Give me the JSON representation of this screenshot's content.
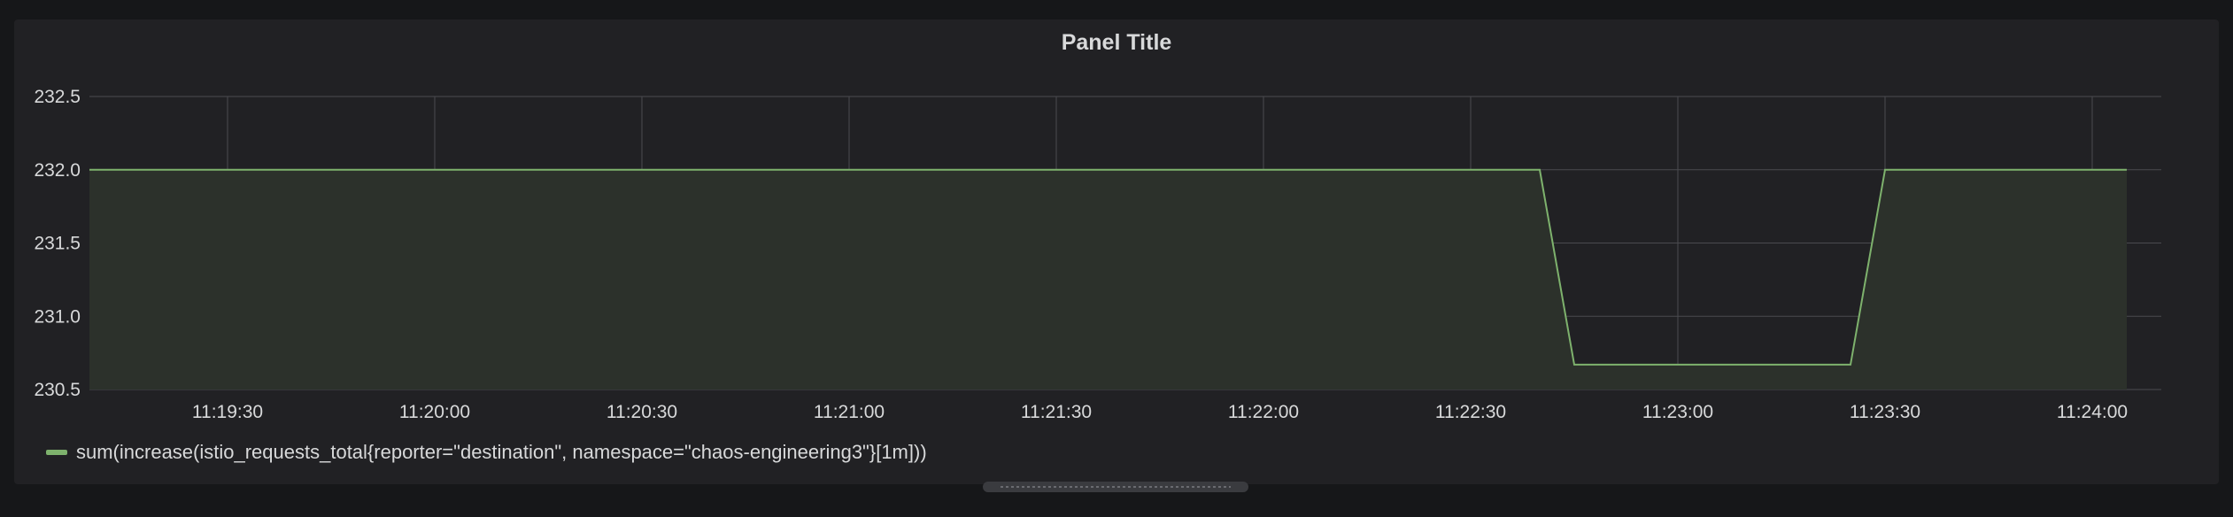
{
  "panel": {
    "title": "Panel Title"
  },
  "colors": {
    "series": "#7eb26d",
    "fill": "#2c312b",
    "grid": "#4a4b4f",
    "text": "#d8d9da"
  },
  "chart_data": {
    "type": "line",
    "title": "Panel Title",
    "xlabel": "",
    "ylabel": "",
    "ylim": [
      230.5,
      232.5
    ],
    "xlim": [
      "11:19:10",
      "11:24:10"
    ],
    "yticks": [
      "230.5",
      "231.0",
      "231.5",
      "232.0",
      "232.5"
    ],
    "xticks": [
      "11:19:30",
      "11:20:00",
      "11:20:30",
      "11:21:00",
      "11:21:30",
      "11:22:00",
      "11:22:30",
      "11:23:00",
      "11:23:30",
      "11:24:00"
    ],
    "grid": true,
    "legend": "bottom-left",
    "series": [
      {
        "name": "sum(increase(istio_requests_total{reporter=\"destination\", namespace=\"chaos-engineering3\"}[1m]))",
        "x": [
          "11:19:10",
          "11:22:40",
          "11:22:45",
          "11:23:25",
          "11:23:30",
          "11:24:05"
        ],
        "y": [
          232.0,
          232.0,
          230.67,
          230.67,
          232.0,
          232.0
        ]
      }
    ]
  }
}
